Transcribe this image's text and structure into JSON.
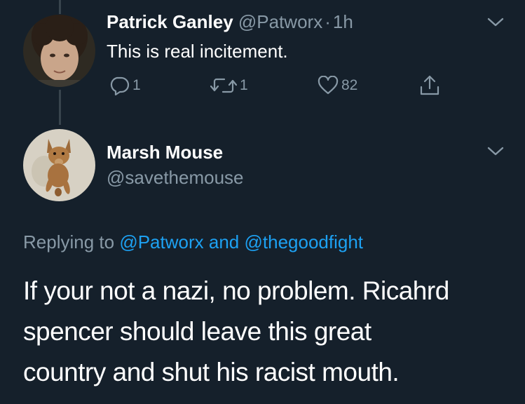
{
  "tweet1": {
    "display_name": "Patrick Ganley",
    "handle": "@Patworx",
    "separator": "·",
    "time": "1h",
    "text": "This is real incitement.",
    "replies": "1",
    "retweets": "1",
    "likes": "82",
    "icons": [
      "reply-icon",
      "retweet-icon",
      "like-icon",
      "share-icon",
      "chevron-down-icon"
    ]
  },
  "tweet2": {
    "display_name": "Marsh Mouse",
    "handle": "@savethemouse",
    "replying_prefix": "Replying to",
    "replying_user1": "@Patworx",
    "replying_and": "and",
    "replying_user2": "@thegoodfight",
    "text_line1": "If your not a nazi, no problem. Ricahrd",
    "text_line2": "spencer should leave this great",
    "text_line3": "country and shut his racist mouth.",
    "icons": [
      "chevron-down-icon"
    ]
  },
  "colors": {
    "background": "#15202b",
    "text": "#ffffff",
    "muted": "#8899a6",
    "link": "#1da1f2",
    "thread_line": "#38444d"
  }
}
